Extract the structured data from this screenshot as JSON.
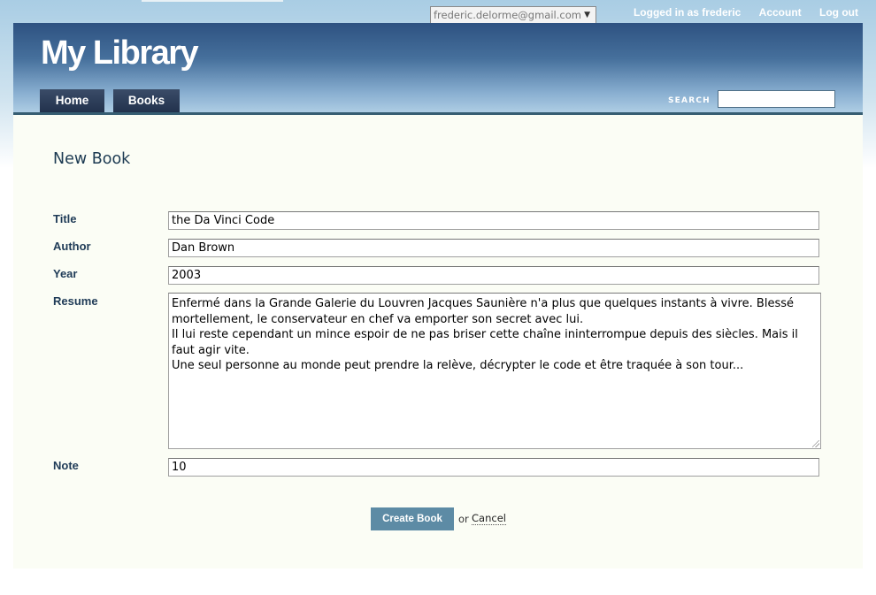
{
  "top_bar": {
    "account_email": "frederic.delorme@gmail.com",
    "logged_in_text": "Logged in as frederic",
    "account_link": "Account",
    "logout_link": "Log out"
  },
  "header": {
    "logo": "My Library",
    "nav": [
      {
        "label": "Home"
      },
      {
        "label": "Books"
      }
    ],
    "search_label": "SEARCH",
    "search_value": ""
  },
  "form": {
    "title": "New Book",
    "fields": {
      "title": {
        "label": "Title",
        "value": "the Da Vinci Code"
      },
      "author": {
        "label": "Author",
        "value": "Dan Brown"
      },
      "year": {
        "label": "Year",
        "value": "2003"
      },
      "resume": {
        "label": "Resume",
        "lines": [
          "Enfermé dans la Grande Galerie du Louvren Jacques Saunière n'a plus que quelques instants à vivre. Blessé mortellement, le conservateur en chef va emporter son secret avec lui.",
          "Il lui reste cependant un mince espoir de ne pas briser cette chaîne ininterrompue depuis des siècles. Mais il faut agir vite.",
          "Une seul personne au monde peut prendre la relève, décrypter le code et être traquée à son tour..."
        ]
      },
      "note": {
        "label": "Note",
        "value": "10"
      }
    },
    "submit_label": "Create Book",
    "or_text": "or",
    "cancel_label": "Cancel"
  },
  "colors": {
    "header_dark": "#2e5281",
    "nav_tab": "#2a3a55",
    "label_text": "#1f3b57",
    "button": "#5d8ba5",
    "content_bg": "#fbfdf5"
  },
  "icons": {
    "select_arrow": "chevron-down-icon",
    "textarea_resize": "resize-grip-icon"
  }
}
